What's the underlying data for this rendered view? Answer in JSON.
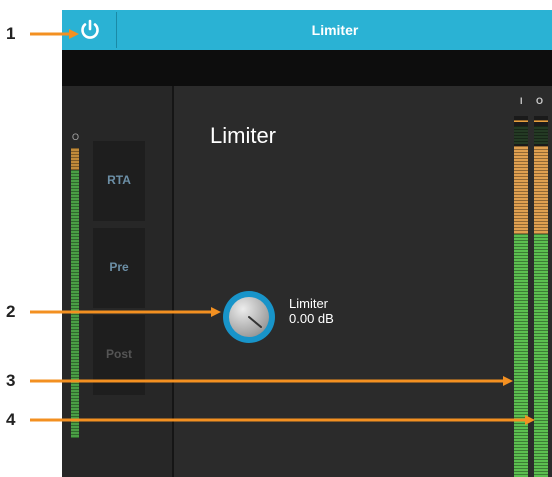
{
  "header": {
    "title": "Limiter"
  },
  "left_meter": {
    "label": "O",
    "fill_fraction": 0.95
  },
  "buttons": {
    "rta": "RTA",
    "pre": "Pre",
    "post": "Post"
  },
  "panel": {
    "title": "Limiter",
    "knob": {
      "label": "Limiter",
      "value": "0.00 dB"
    }
  },
  "meters": {
    "input": {
      "label": "I",
      "fill_fraction": 0.95
    },
    "output": {
      "label": "O",
      "fill_fraction": 0.95
    }
  },
  "callouts": [
    "1",
    "2",
    "3",
    "4"
  ],
  "colors": {
    "accent": "#2ab2d4",
    "meter_green": "#4caf50",
    "meter_orange": "#e89a3c",
    "callout_arrow": "#f39021"
  }
}
